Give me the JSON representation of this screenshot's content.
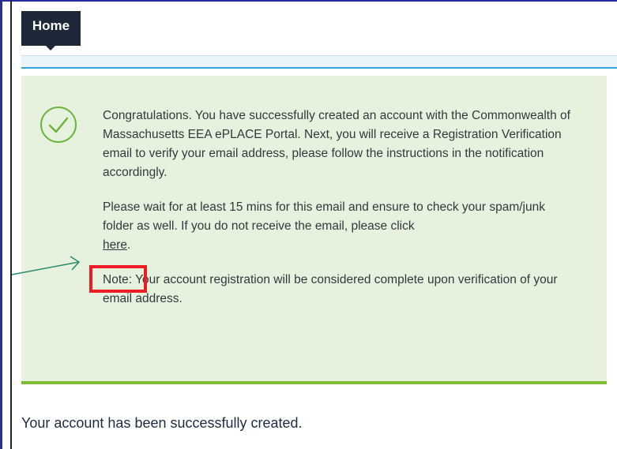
{
  "nav": {
    "home_label": "Home"
  },
  "notice": {
    "icon": "check-circle-icon",
    "para1": "Congratulations. You have successfully created an account with the Commonwealth of Massachusetts EEA ePLACE Portal. Next, you will receive a Registration Verification email to verify your email address, please follow the instructions in the notification accordingly.",
    "para2_text": "Please wait for at least 15 mins for this email and ensure to check your spam/junk folder as well. If you do not receive the email, please click",
    "para2_link": "here",
    "para2_end": ".",
    "para3": "Note: Your account registration will be considered complete upon verification of your email address."
  },
  "footer": {
    "success_message": "Your account has been successfully created."
  },
  "colors": {
    "tab_bg": "#1d2839",
    "notice_bg": "#e6f2de",
    "notice_border": "#7cbb32",
    "highlight": "#ee1c24",
    "arrow": "#2e8b6e"
  }
}
